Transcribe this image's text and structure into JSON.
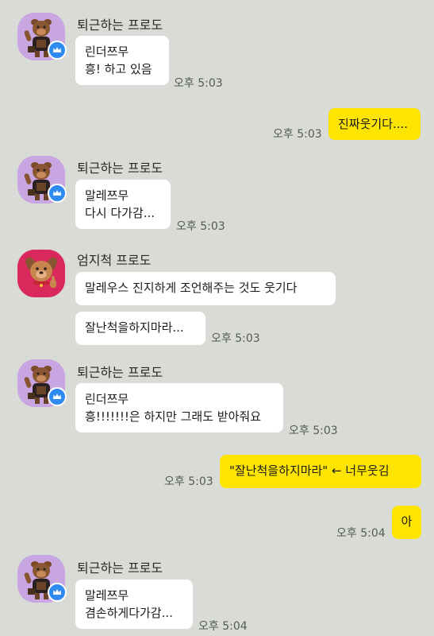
{
  "colors": {
    "background": "#d9dcd6",
    "incoming_bubble": "#ffffff",
    "outgoing_bubble": "#fee500",
    "badge": "#2f8bf0",
    "avatar_purple": "#c8a6e2",
    "avatar_red": "#d9285b"
  },
  "messages": [
    {
      "type": "incoming",
      "sender": "퇴근하는 프로도",
      "lines": [
        "린더쯔무",
        "흥! 하고 있음"
      ],
      "time": "오후 5:03",
      "avatar": "frodo-purple-icon"
    },
    {
      "type": "outgoing",
      "text": "진짜웃기다....",
      "time": "오후 5:03"
    },
    {
      "type": "incoming",
      "sender": "퇴근하는 프로도",
      "lines": [
        "말레쯔무",
        "다시 다가감..."
      ],
      "time": "오후 5:03",
      "avatar": "frodo-purple-icon"
    },
    {
      "type": "incoming",
      "sender": "엄지척 프로도",
      "lines": [
        "말레우스 진지하게 조언해주는 것도 웃기다"
      ],
      "avatar": "frodo-thumbsup-icon"
    },
    {
      "type": "incoming-continued",
      "lines": [
        "잘난척을하지마라..."
      ],
      "time": "오후 5:03"
    },
    {
      "type": "incoming",
      "sender": "퇴근하는 프로도",
      "lines": [
        "린더쯔무",
        "흥!!!!!!!은 하지만 그래도 받아줘요"
      ],
      "time": "오후 5:03",
      "avatar": "frodo-purple-icon"
    },
    {
      "type": "outgoing",
      "text": "\"잘난척을하지마라\" ← 너무웃김",
      "time": "오후 5:03"
    },
    {
      "type": "outgoing",
      "text": "아",
      "time": "오후 5:04"
    },
    {
      "type": "incoming",
      "sender": "퇴근하는 프로도",
      "lines": [
        "말레쯔무",
        "겸손하게다가감..."
      ],
      "time": "오후 5:04",
      "avatar": "frodo-purple-icon"
    }
  ]
}
